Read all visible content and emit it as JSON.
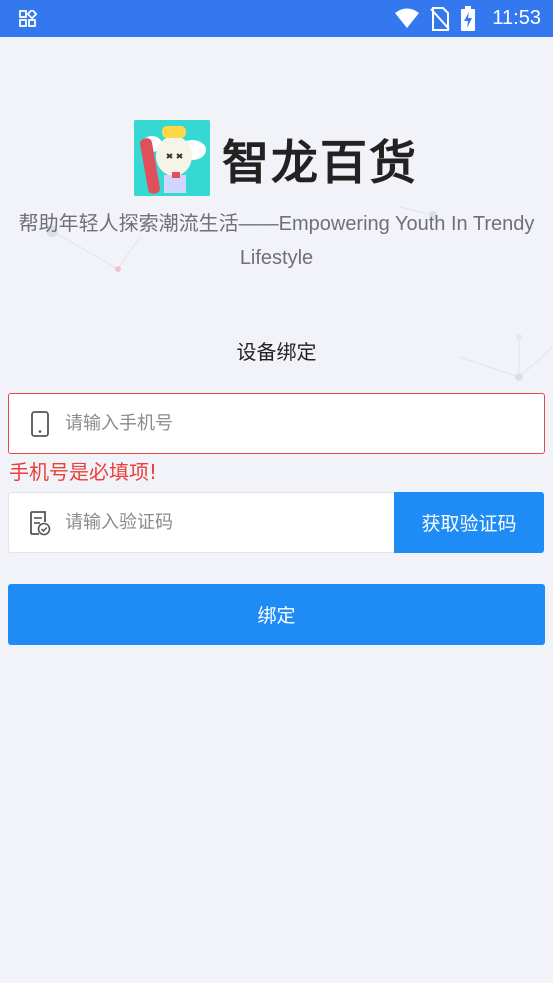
{
  "status_bar": {
    "time": "11:53",
    "icons": [
      "apps-grid-icon",
      "wifi-icon",
      "no-sim-icon",
      "battery-charging-icon"
    ]
  },
  "brand": {
    "name": "智龙百货",
    "logo_icon": "mascot-logo"
  },
  "slogan": "帮助年轻人探索潮流生活——Empowering Youth In Trendy Lifestyle",
  "form": {
    "title": "设备绑定",
    "phone": {
      "value": "",
      "placeholder": "请输入手机号",
      "icon": "phone-icon"
    },
    "phone_error": "手机号是必填项!",
    "code": {
      "value": "",
      "placeholder": "请输入验证码",
      "icon": "verify-doc-icon"
    },
    "get_code_label": "获取验证码",
    "submit_label": "绑定"
  },
  "colors": {
    "status_bar": "#3478f0",
    "primary": "#1f8cf5",
    "error": "#e8403a",
    "background": "#f2f3f8"
  }
}
